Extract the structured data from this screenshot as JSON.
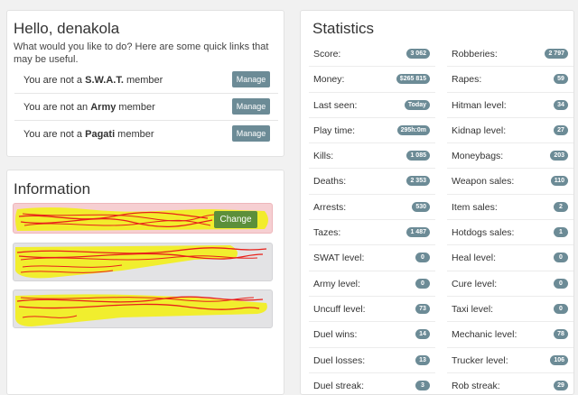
{
  "hello": {
    "title": "Hello, denakola",
    "intro": "What would you like to do? Here are some quick links that may be useful.",
    "memberships": [
      {
        "prefix": "You are not a ",
        "group": "S.W.A.T.",
        "suffix": " member",
        "button": "Manage"
      },
      {
        "prefix": "You are not an ",
        "group": "Army",
        "suffix": " member",
        "button": "Manage"
      },
      {
        "prefix": "You are not a ",
        "group": "Pagati",
        "suffix": " member",
        "button": "Manage"
      }
    ]
  },
  "information": {
    "title": "Information",
    "change_button": "Change"
  },
  "statistics": {
    "title": "Statistics",
    "left": [
      {
        "label": "Score:",
        "value": "3 062"
      },
      {
        "label": "Money:",
        "value": "$265 815"
      },
      {
        "label": "Last seen:",
        "value": "Today"
      },
      {
        "label": "Play time:",
        "value": "295h:0m"
      },
      {
        "label": "Kills:",
        "value": "1 085"
      },
      {
        "label": "Deaths:",
        "value": "2 353"
      },
      {
        "label": "Arrests:",
        "value": "530"
      },
      {
        "label": "Tazes:",
        "value": "1 487"
      },
      {
        "label": "SWAT level:",
        "value": "0"
      },
      {
        "label": "Army level:",
        "value": "0"
      },
      {
        "label": "Uncuff level:",
        "value": "73"
      },
      {
        "label": "Duel wins:",
        "value": "14"
      },
      {
        "label": "Duel losses:",
        "value": "13"
      },
      {
        "label": "Duel streak:",
        "value": "3"
      }
    ],
    "right": [
      {
        "label": "Robberies:",
        "value": "2 797"
      },
      {
        "label": "Rapes:",
        "value": "59"
      },
      {
        "label": "Hitman level:",
        "value": "34"
      },
      {
        "label": "Kidnap level:",
        "value": "27"
      },
      {
        "label": "Moneybags:",
        "value": "203"
      },
      {
        "label": "Weapon sales:",
        "value": "110"
      },
      {
        "label": "Item sales:",
        "value": "2"
      },
      {
        "label": "Hotdogs sales:",
        "value": "1"
      },
      {
        "label": "Heal level:",
        "value": "0"
      },
      {
        "label": "Cure level:",
        "value": "0"
      },
      {
        "label": "Taxi level:",
        "value": "0"
      },
      {
        "label": "Mechanic level:",
        "value": "78"
      },
      {
        "label": "Trucker level:",
        "value": "106"
      },
      {
        "label": "Rob streak:",
        "value": "29"
      }
    ]
  },
  "colors": {
    "badge": "#6c8b96",
    "highlight": "#f2ee1a",
    "scribble": "#e8201a",
    "change_button": "#5c8f3a"
  }
}
